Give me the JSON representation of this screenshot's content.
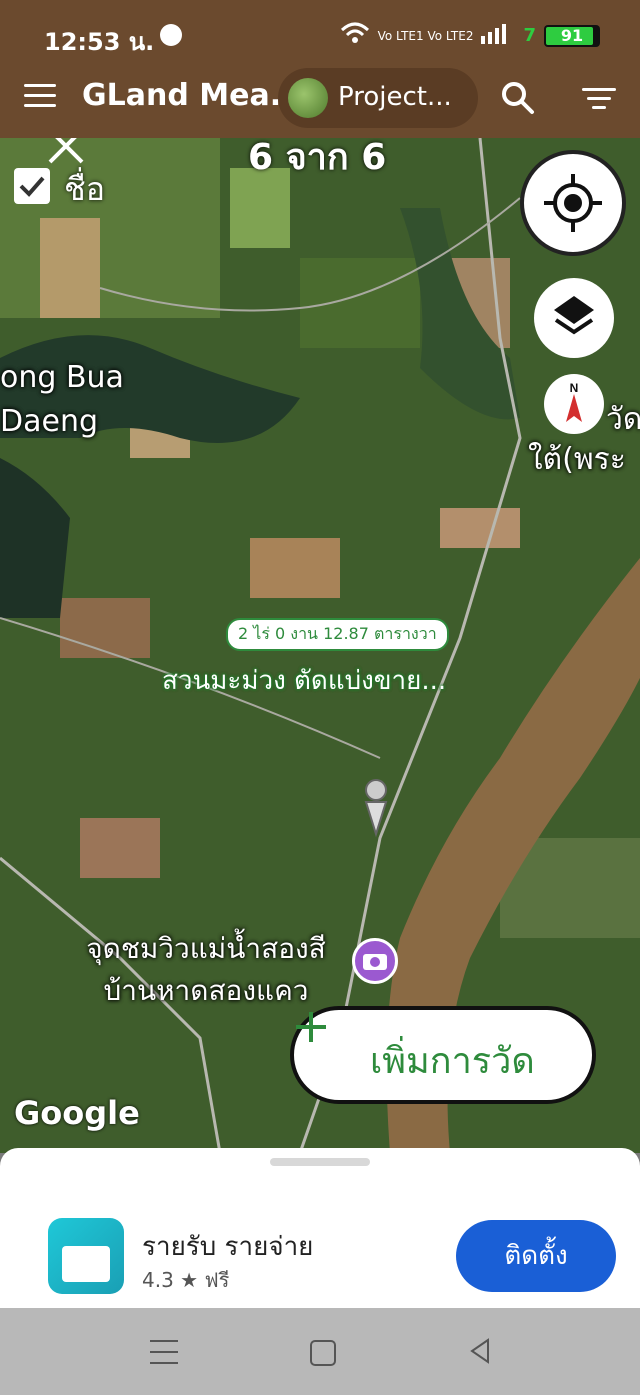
{
  "status_bar": {
    "time": "12:53 น.",
    "network": "Vo LTE1 Vo LTE2",
    "battery_level": 0.91,
    "battery_label": "91",
    "extra": "7"
  },
  "app_bar": {
    "title": "GLand Mea...",
    "project_label": "Project..."
  },
  "map": {
    "counter": "6 จาก 6",
    "name_toggle_label": "ชื่อ",
    "name_toggle_checked": true,
    "place_labels": [
      "ong Bua",
      "Daeng",
      "วัด",
      "ใต้(พระ"
    ],
    "area_badge": "2 ไร่ 0 งาน 12.87 ตารางวา",
    "land_name": "สวนมะม่วง ตัดแบ่งขาย...",
    "poi_label": "จุดชมวิวแม่น้ำสองสี บ้านหาดสองแคว",
    "add_measure_label": "เพิ่มการวัด",
    "google_logo": "Google"
  },
  "ad": {
    "title": "รายรับ รายจ่าย",
    "rating": "4.3",
    "price": "ฟรี",
    "install_label": "ติดตั้ง"
  },
  "icons": {
    "menu": "menu-icon",
    "search": "search-icon",
    "filter": "filter-icon",
    "close": "close-icon",
    "locate": "my-location-icon",
    "layers": "layers-icon",
    "compass": "compass-icon",
    "camera": "camera-poi-icon"
  },
  "colors": {
    "app_bar": "#6b4a2e",
    "accent_green": "#2e8b3c",
    "install_blue": "#1a5fd6"
  }
}
